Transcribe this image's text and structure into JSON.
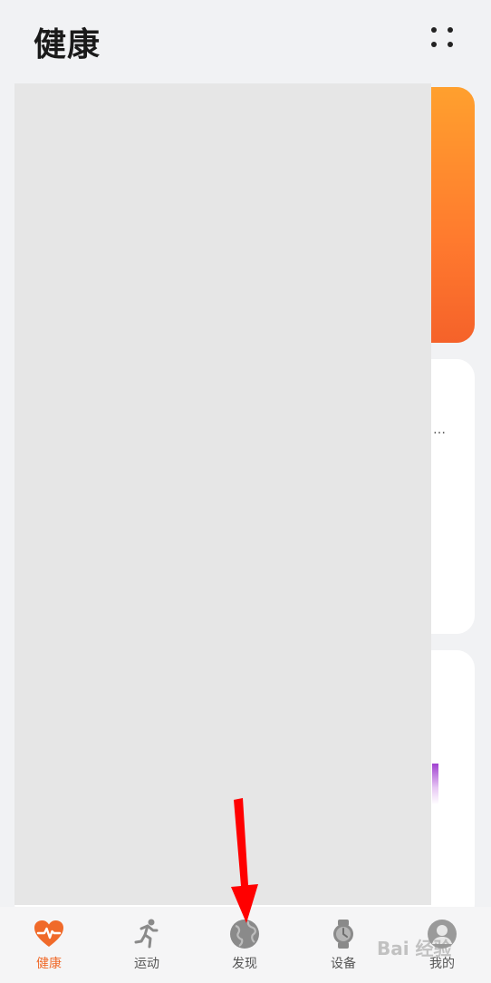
{
  "header": {
    "title": "健康",
    "more_icon": "more-dots-icon"
  },
  "cards": {
    "ellipsis_text": "…"
  },
  "bottom_nav": {
    "items": [
      {
        "label": "健康",
        "icon": "heart-pulse-icon",
        "active": true
      },
      {
        "label": "运动",
        "icon": "running-person-icon",
        "active": false
      },
      {
        "label": "发现",
        "icon": "globe-icon",
        "active": false
      },
      {
        "label": "设备",
        "icon": "watch-icon",
        "active": false
      },
      {
        "label": "我的",
        "icon": "user-avatar-icon",
        "active": false
      }
    ]
  },
  "colors": {
    "accent": "#f06a2a",
    "orange_card_top": "#ffa02e",
    "orange_card_bottom": "#f5622a",
    "annotation_arrow": "#ff0000",
    "overlay": "#e6e6e6"
  },
  "watermark": {
    "text": "Bai 经验"
  }
}
